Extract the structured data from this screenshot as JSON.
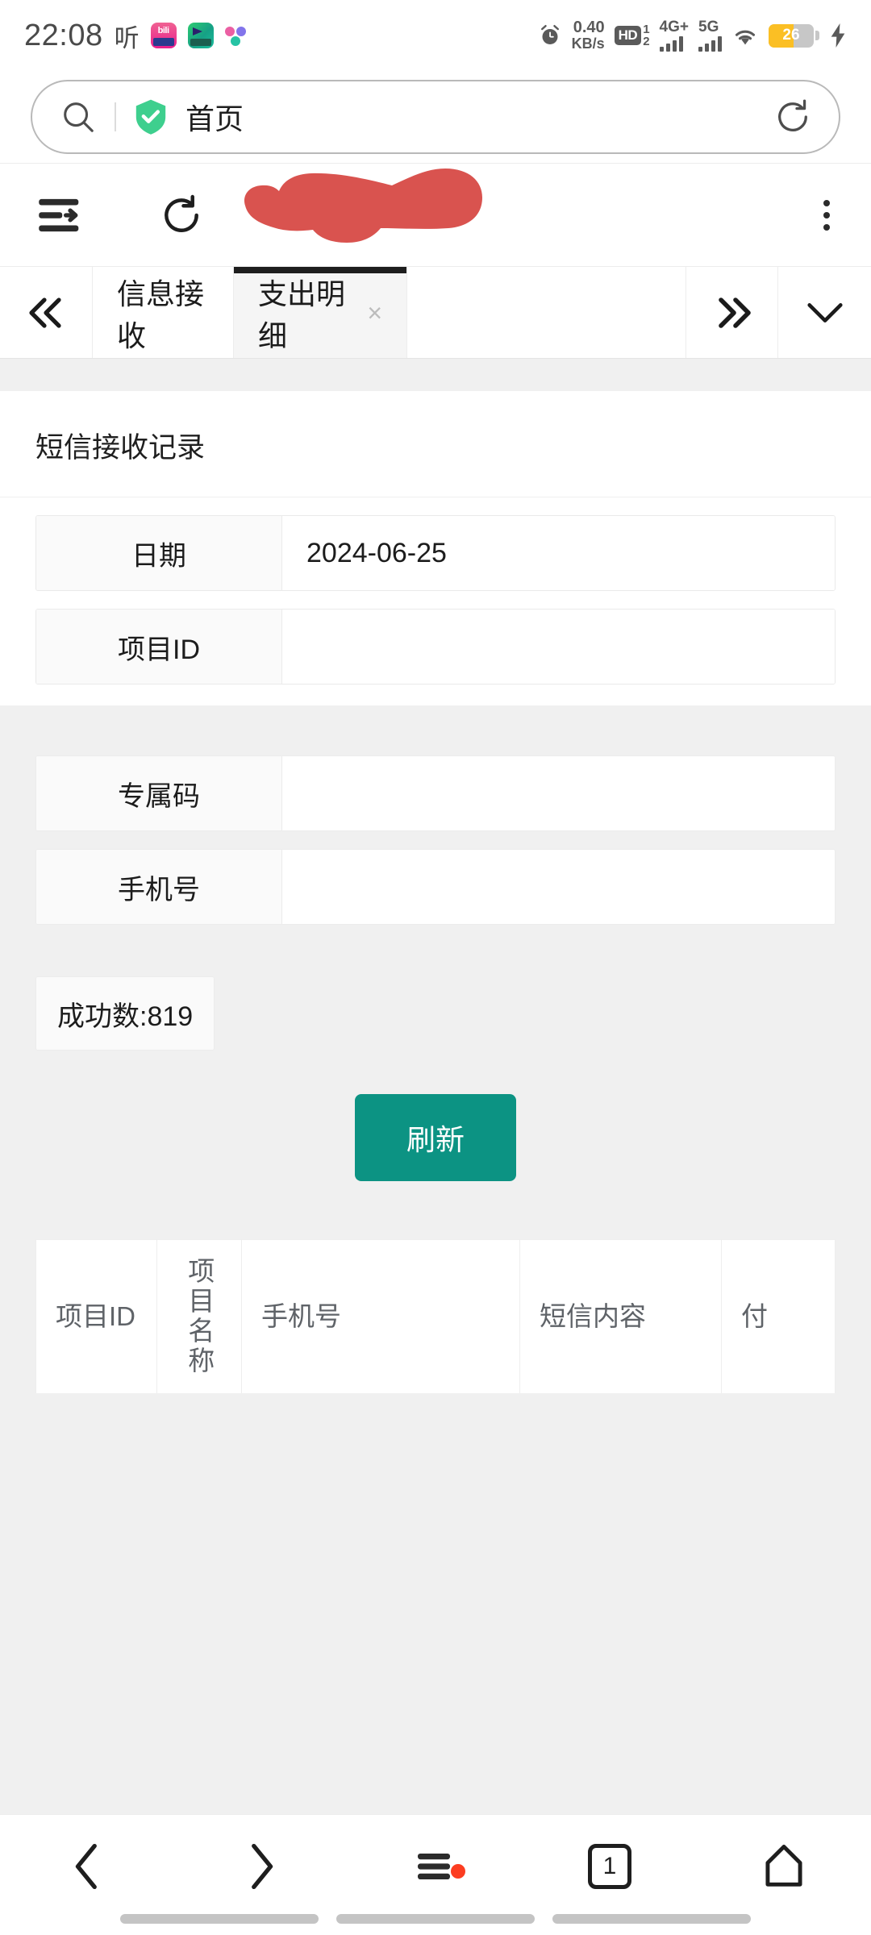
{
  "status_bar": {
    "time": "22:08",
    "listening_label": "听",
    "app_icons": [
      "bilibili-icon",
      "video-app-icon",
      "multicolor-app-icon"
    ],
    "network_speed": "0.40",
    "network_speed_unit": "KB/s",
    "hd_label": "HD",
    "hd_sim1": "1",
    "hd_sim2": "2",
    "signal1_label": "4G+",
    "signal2_label": "5G",
    "battery_percent": "26",
    "charging": true,
    "icons": {
      "alarm": "alarm-clock-icon",
      "wifi": "wifi-icon",
      "battery": "battery-icon",
      "bolt": "charging-bolt-icon"
    }
  },
  "omnibox": {
    "search_icon": "search-icon",
    "shield_icon": "shield-check-icon",
    "title": "首页",
    "reload_icon": "reload-icon"
  },
  "browser_toolbar": {
    "sidebar_icon": "list-arrow-icon",
    "refresh_icon": "refresh-icon",
    "redacted_area": "red-scribble-redaction",
    "redaction_color": "#d9534f",
    "more_icon": "more-vertical-icon"
  },
  "tab_strip": {
    "prev_icon": "double-chevron-left-icon",
    "next_icon": "double-chevron-right-icon",
    "expand_icon": "chevron-down-icon",
    "tabs": [
      {
        "label": "信息接收",
        "active": false,
        "closable": false
      },
      {
        "label": "支出明细",
        "active": true,
        "closable": true,
        "close_glyph": "×"
      }
    ]
  },
  "page": {
    "title": "短信接收记录",
    "form_top": [
      {
        "label": "日期",
        "value": "2024-06-25",
        "placeholder": ""
      },
      {
        "label": "项目ID",
        "value": "",
        "placeholder": ""
      }
    ],
    "form_bottom": [
      {
        "label": "专属码",
        "value": "",
        "placeholder": ""
      },
      {
        "label": "手机号",
        "value": "",
        "placeholder": ""
      }
    ],
    "success_count_label": "成功数:819",
    "refresh_button": {
      "label": "刷新",
      "color": "#0c9383"
    },
    "table": {
      "columns": [
        "项目ID",
        "项目名称",
        "手机号",
        "短信内容",
        "付"
      ],
      "rows": []
    }
  },
  "bottom_nav": {
    "back_icon": "chevron-left-icon",
    "forward_icon": "chevron-right-icon",
    "menu_icon": "hamburger-menu-icon",
    "menu_badge_color": "#fc3d21",
    "tab_count": "1",
    "home_icon": "home-icon"
  }
}
